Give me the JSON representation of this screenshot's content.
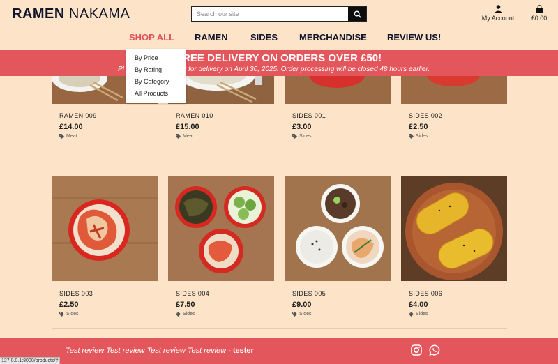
{
  "header": {
    "logo_bold": "RAMEN",
    "logo_light": "NAKAMA",
    "search_placeholder": "Search our site",
    "account_label": "My Account",
    "bag_total": "£0.00"
  },
  "nav": {
    "items": [
      "SHOP ALL",
      "RAMEN",
      "SIDES",
      "MERCHANDISE",
      "REVIEW US!"
    ]
  },
  "dropdown": {
    "items": [
      "By Price",
      "By Rating",
      "By Category",
      "All Products"
    ]
  },
  "banner": {
    "headline": "FREE DELIVERY ON ORDERS OVER £50!",
    "notice_start": "Pl",
    "notice_end": "r for delivery on April 30, 2025. Order processing will be closed 48 hours earlier."
  },
  "products": [
    {
      "name": "RAMEN 009",
      "price": "£14.00",
      "category": "Meat"
    },
    {
      "name": "RAMEN 010",
      "price": "£15.00",
      "category": "Meat"
    },
    {
      "name": "SIDES 001",
      "price": "£3.00",
      "category": "Sides"
    },
    {
      "name": "SIDES 002",
      "price": "£2.50",
      "category": "Sides"
    },
    {
      "name": "SIDES 003",
      "price": "£2.50",
      "category": "Sides"
    },
    {
      "name": "SIDES 004",
      "price": "£7.50",
      "category": "Sides"
    },
    {
      "name": "SIDES 005",
      "price": "£9.00",
      "category": "Sides"
    },
    {
      "name": "SIDES 006",
      "price": "£4.00",
      "category": "Sides"
    }
  ],
  "footer": {
    "review_text": "Test review Test review Test review Test review - ",
    "review_author": "tester",
    "icons": [
      "instagram-icon",
      "whatsapp-icon"
    ]
  },
  "status_url": "127.0.0.1:8000/products/#",
  "colors": {
    "background": "#fde4c8",
    "accent": "#e2565c",
    "nav_active": "#e0525a",
    "navy": "#10152b"
  }
}
